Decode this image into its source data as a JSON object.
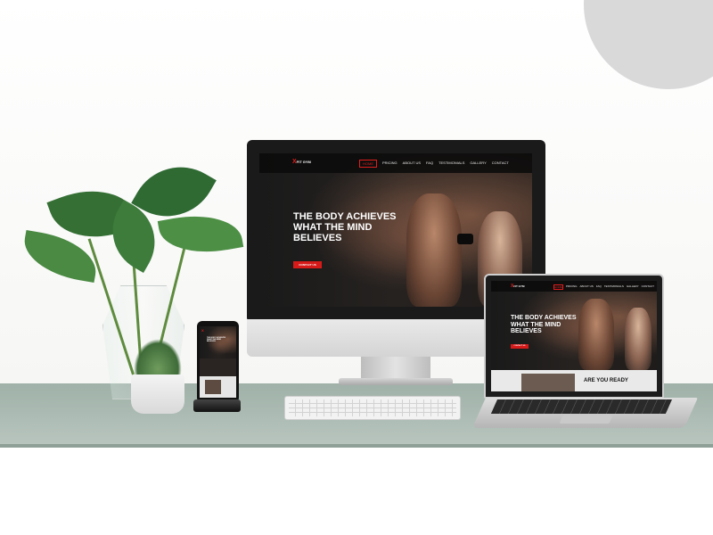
{
  "site": {
    "logo_mark": "X",
    "logo_text": "FIT GYM",
    "menu": [
      "HOME",
      "PRICING",
      "ABOUT US",
      "FAQ",
      "TESTIMONIALS",
      "GALLERY",
      "CONTACT"
    ],
    "active_menu": "HOME",
    "headline_line1": "THE BODY ACHIEVES",
    "headline_line2": "WHAT THE MIND",
    "headline_line3": "BELIEVES",
    "cta_label": "CONTACT US",
    "section_title": "ARE YOU READY"
  },
  "colors": {
    "accent": "#e11d1d",
    "site_background": "#141414",
    "desk": "#a9b8b0",
    "decor_circle": "#d9d9d9"
  },
  "devices": [
    "desktop-monitor",
    "laptop",
    "smartphone",
    "keyboard"
  ]
}
